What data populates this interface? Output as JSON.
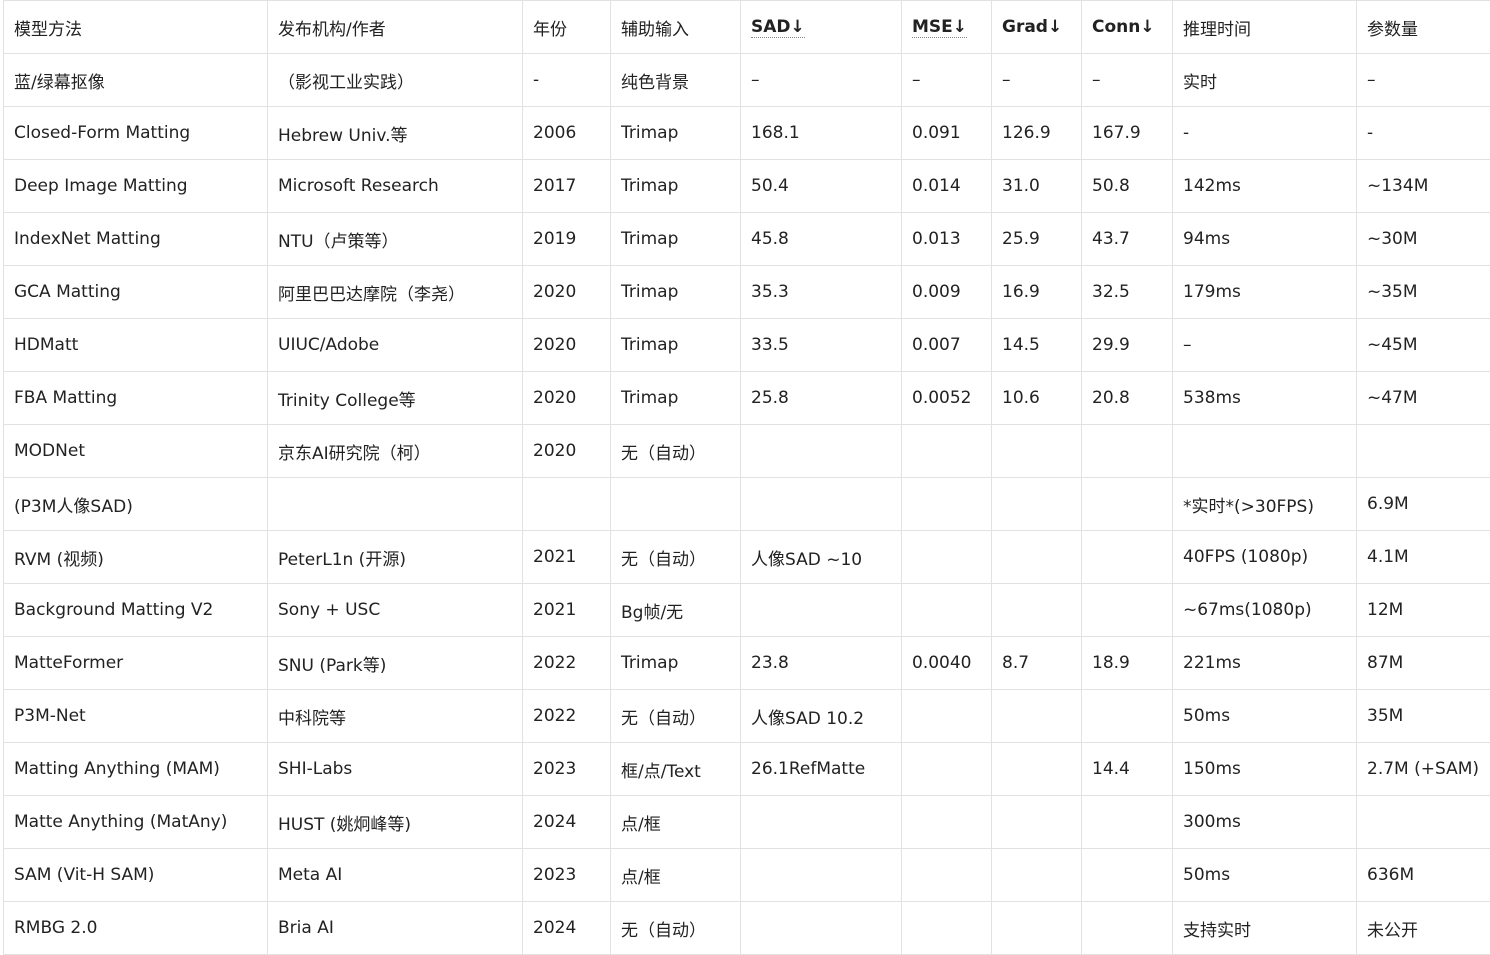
{
  "table": {
    "headers": [
      "模型方法",
      "发布机构/作者",
      "年份",
      "辅助输入",
      "SAD↓",
      "MSE↓",
      "Grad↓",
      "Conn↓",
      "推理时间",
      "参数量"
    ],
    "rows": [
      [
        "蓝/绿幕抠像",
        "（影视工业实践）",
        "-",
        "纯色背景",
        "–",
        "–",
        "–",
        "–",
        "实时",
        "–"
      ],
      [
        "Closed-Form Matting",
        "Hebrew Univ.等",
        "2006",
        "Trimap",
        "168.1",
        "0.091",
        "126.9",
        "167.9",
        "-",
        "-"
      ],
      [
        "Deep Image Matting",
        "Microsoft Research",
        "2017",
        "Trimap",
        "50.4",
        "0.014",
        "31.0",
        "50.8",
        "142ms",
        "~134M"
      ],
      [
        "IndexNet Matting",
        "NTU（卢策等）",
        "2019",
        "Trimap",
        "45.8",
        "0.013",
        "25.9",
        "43.7",
        "94ms",
        "~30M"
      ],
      [
        "GCA Matting",
        "阿里巴巴达摩院（李尧）",
        "2020",
        "Trimap",
        "35.3",
        "0.009",
        "16.9",
        "32.5",
        "179ms",
        "~35M"
      ],
      [
        "HDMatt",
        "UIUC/Adobe",
        "2020",
        "Trimap",
        "33.5",
        "0.007",
        "14.5",
        "29.9",
        "–",
        "~45M"
      ],
      [
        "FBA Matting",
        "Trinity College等",
        "2020",
        "Trimap",
        "25.8",
        "0.0052",
        "10.6",
        "20.8",
        "538ms",
        "~47M"
      ],
      [
        "MODNet",
        "京东AI研究院（柯）",
        "2020",
        "无（自动）",
        "",
        "",
        "",
        "",
        "",
        ""
      ],
      [
        "(P3M人像SAD)",
        "",
        "",
        "",
        "",
        "",
        "",
        "",
        "*实时*(>30FPS)",
        "6.9M"
      ],
      [
        " RVM (视频)",
        "PeterL1n (开源)",
        "2021",
        "无（自动）",
        " 人像SAD ~10",
        "",
        "",
        "",
        " 40FPS (1080p)",
        "4.1M"
      ],
      [
        "Background Matting V2",
        " Sony + USC",
        "2021",
        "Bg帧/无",
        "",
        "",
        "",
        "",
        "~67ms(1080p)",
        " 12M"
      ],
      [
        "MatteFormer",
        "SNU (Park等)",
        "2022",
        "Trimap",
        "23.8",
        "0.0040",
        "8.7",
        "18.9",
        "221ms",
        "87M"
      ],
      [
        "P3M-Net",
        "中科院等",
        "2022",
        "无（自动）",
        "人像SAD 10.2",
        "",
        "",
        "",
        "50ms",
        "35M"
      ],
      [
        "Matting Anything (MAM)",
        "SHI-Labs",
        "2023",
        "框/点/Text",
        "26.1RefMatte",
        "",
        "",
        "14.4",
        "150ms",
        "2.7M (+SAM)"
      ],
      [
        "Matte Anything (MatAny)",
        "HUST (姚炯峰等)",
        "2024",
        "点/框",
        "",
        "",
        "",
        "",
        "300ms",
        ""
      ],
      [
        "SAM (Vit-H SAM)",
        "Meta AI",
        "2023",
        "点/框",
        "",
        "",
        "",
        "",
        "50ms",
        "636M"
      ],
      [
        "RMBG 2.0",
        "Bria AI",
        "2024",
        "无（自动）",
        "",
        "",
        "",
        "",
        "支持实时",
        "未公开"
      ]
    ]
  }
}
